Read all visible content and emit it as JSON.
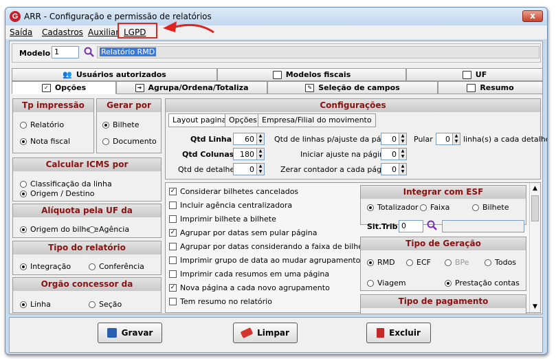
{
  "window": {
    "title": "ARR - Configuração e permissão de relatórios",
    "close_label": "x"
  },
  "menu": [
    "Saída",
    "Cadastros",
    "Auxiliar",
    "LGPD"
  ],
  "modelo": {
    "label": "Modelo",
    "code": "1",
    "name": "Relatório RMD"
  },
  "tabs_top": [
    "Usuários autorizados",
    "Modelos fiscais",
    "UF"
  ],
  "tabs_bottom": [
    "Opções",
    "Agrupa/Ordena/Totaliza",
    "Seleção de campos",
    "Resumo"
  ],
  "tp_impressao": {
    "title": "Tp impressão",
    "options": [
      "Relatório",
      "Nota fiscal"
    ],
    "selected": "Nota fiscal"
  },
  "gerar_por": {
    "title": "Gerar por",
    "options": [
      "Bilhete",
      "Documento"
    ],
    "selected": "Bilhete"
  },
  "icms": {
    "title": "Calcular ICMS por",
    "options": [
      "Classificação da linha",
      "Origem / Destino"
    ],
    "selected": "Origem / Destino"
  },
  "aliquota": {
    "title": "Alíquota pela UF da",
    "options": [
      "Origem do bilhete",
      "Agência"
    ],
    "selected": "Origem do bilhete"
  },
  "tipo_relatorio": {
    "title": "Tipo do relatório",
    "options": [
      "Integração",
      "Conferência"
    ],
    "selected": "Integração"
  },
  "orgao": {
    "title": "Orgão concessor da",
    "options": [
      "Linha",
      "Seção"
    ],
    "selected": "Linha"
  },
  "config": {
    "title": "Configurações",
    "subtabs": [
      "Layout pagina",
      "Opções",
      "Empresa/Filial do movimento"
    ],
    "qtd_linha": {
      "label": "Qtd Linha",
      "value": "60"
    },
    "qtd_colunas": {
      "label": "Qtd Colunas",
      "value": "180"
    },
    "qtd_detalhes": {
      "label": "Qtd de detalhes",
      "value": "0"
    },
    "linhas_ajuste": {
      "label": "Qtd de linhas p/ajuste da página",
      "value": "0"
    },
    "iniciar_ajuste": {
      "label": "Iniciar ajuste na página",
      "value": "0"
    },
    "zerar_contador": {
      "label": "Zerar contador a cada página",
      "value": "0"
    },
    "pular": {
      "label": "Pular",
      "value": "0",
      "suffix": "linha(s) a cada detalhe"
    }
  },
  "checkboxes": [
    {
      "label": "Considerar bilhetes cancelados",
      "checked": true
    },
    {
      "label": "Incluir agência centralizadora",
      "checked": false
    },
    {
      "label": "Imprimir bilhete a bilhete",
      "checked": false
    },
    {
      "label": "Agrupar por datas sem pular página",
      "checked": true
    },
    {
      "label": "Agrupar por datas considerando a faixa de bilhetes",
      "checked": false
    },
    {
      "label": "Imprimir grupo de data ao mudar agrupamento",
      "checked": false
    },
    {
      "label": "Imprimir cada resumos em uma página",
      "checked": false
    },
    {
      "label": "Nova página a cada novo agrupamento",
      "checked": true
    },
    {
      "label": "Tem resumo no relatório",
      "checked": false
    }
  ],
  "esf": {
    "title": "Integrar com ESF",
    "options": [
      "Totalizador",
      "Faixa",
      "Bilhete"
    ],
    "selected": "Totalizador",
    "sit_trib_label": "Sit.Trib",
    "sit_trib_value": "0"
  },
  "tipo_geracao": {
    "title": "Tipo de Geração",
    "options": [
      "RMD",
      "ECF",
      "BPe",
      "Todos"
    ],
    "selected": "RMD",
    "options2": [
      "Viagem",
      "Prestação contas"
    ],
    "selected2": "Prestação contas"
  },
  "tipo_pagamento": {
    "title": "Tipo de pagamento"
  },
  "buttons": {
    "gravar": "Gravar",
    "limpar": "Limpar",
    "excluir": "Excluir"
  },
  "colors": {
    "highlight": "#e0241e",
    "panel_title": "#8b1111"
  }
}
